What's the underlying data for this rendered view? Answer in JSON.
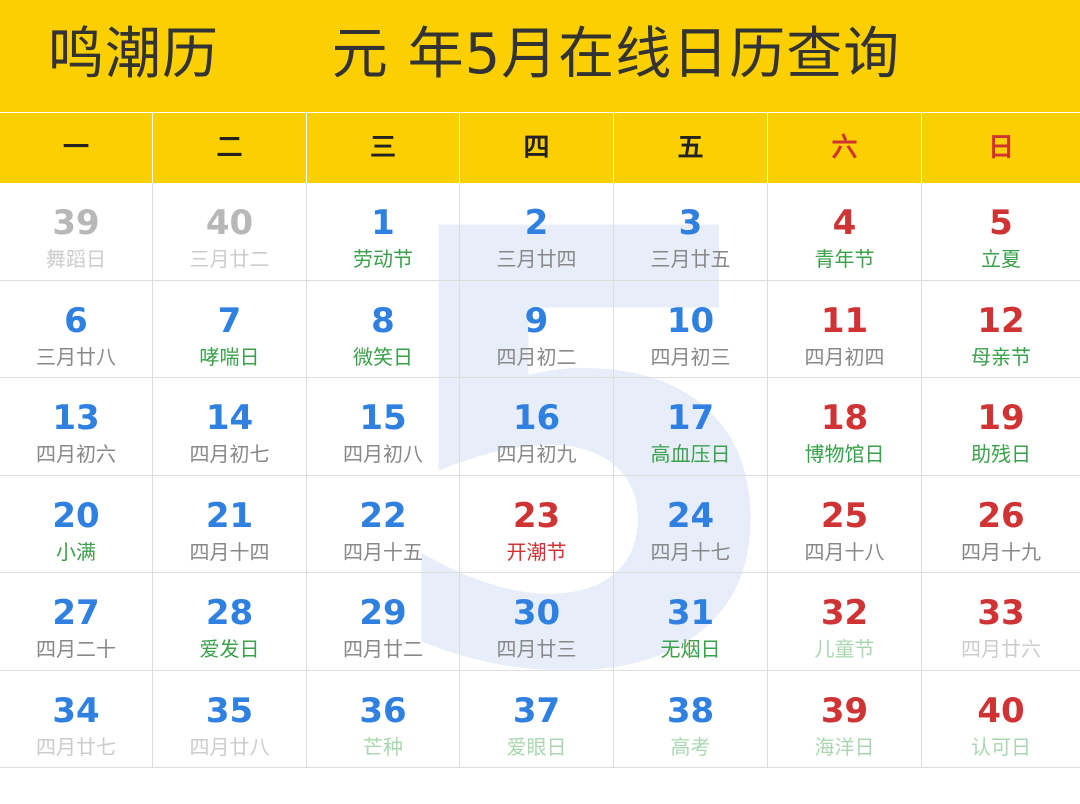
{
  "header": {
    "title": "鸣潮历      元 年5月在线日历查询"
  },
  "watermark": "5",
  "weekdays": [
    "一",
    "二",
    "三",
    "四",
    "五",
    "六",
    "日"
  ],
  "weeks": [
    [
      {
        "day": "39",
        "label": "舞蹈日"
      },
      {
        "day": "40",
        "label": "三月廿二"
      },
      {
        "day": "1",
        "label": "劳动节"
      },
      {
        "day": "2",
        "label": "三月廿四"
      },
      {
        "day": "3",
        "label": "三月廿五"
      },
      {
        "day": "4",
        "label": "青年节"
      },
      {
        "day": "5",
        "label": "立夏"
      }
    ],
    [
      {
        "day": "6",
        "label": "三月廿八"
      },
      {
        "day": "7",
        "label": "哮喘日"
      },
      {
        "day": "8",
        "label": "微笑日"
      },
      {
        "day": "9",
        "label": "四月初二"
      },
      {
        "day": "10",
        "label": "四月初三"
      },
      {
        "day": "11",
        "label": "四月初四"
      },
      {
        "day": "12",
        "label": "母亲节"
      }
    ],
    [
      {
        "day": "13",
        "label": "四月初六"
      },
      {
        "day": "14",
        "label": "四月初七"
      },
      {
        "day": "15",
        "label": "四月初八"
      },
      {
        "day": "16",
        "label": "四月初九"
      },
      {
        "day": "17",
        "label": "高血压日"
      },
      {
        "day": "18",
        "label": "博物馆日"
      },
      {
        "day": "19",
        "label": "助残日"
      }
    ],
    [
      {
        "day": "20",
        "label": "小满"
      },
      {
        "day": "21",
        "label": "四月十四"
      },
      {
        "day": "22",
        "label": "四月十五"
      },
      {
        "day": "23",
        "label": "开潮节"
      },
      {
        "day": "24",
        "label": "四月十七"
      },
      {
        "day": "25",
        "label": "四月十八"
      },
      {
        "day": "26",
        "label": "四月十九"
      }
    ],
    [
      {
        "day": "27",
        "label": "四月二十"
      },
      {
        "day": "28",
        "label": "爱发日"
      },
      {
        "day": "29",
        "label": "四月廿二"
      },
      {
        "day": "30",
        "label": "四月廿三"
      },
      {
        "day": "31",
        "label": "无烟日"
      },
      {
        "day": "32",
        "label": "儿童节"
      },
      {
        "day": "33",
        "label": "四月廿六"
      }
    ],
    [
      {
        "day": "34",
        "label": "四月廿七"
      },
      {
        "day": "35",
        "label": "四月廿八"
      },
      {
        "day": "36",
        "label": "芒种"
      },
      {
        "day": "37",
        "label": "爱眼日"
      },
      {
        "day": "38",
        "label": "高考"
      },
      {
        "day": "39",
        "label": "海洋日"
      },
      {
        "day": "40",
        "label": "认可日"
      }
    ]
  ],
  "colors": {
    "header_yellow": "#FCD000",
    "weekday_blue": "#2f80e0",
    "weekend_red": "#d03333",
    "festival_green": "#3aa04a",
    "lunar_grey": "#888888"
  }
}
